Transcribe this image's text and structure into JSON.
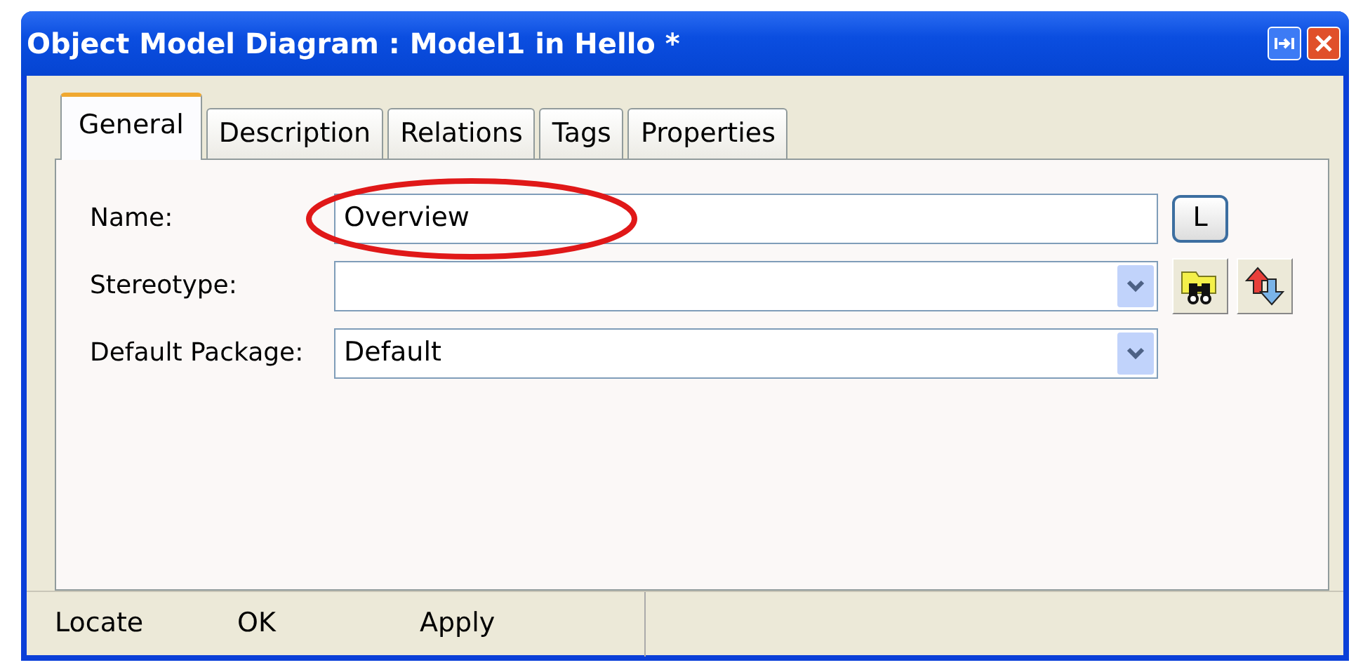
{
  "window": {
    "title": "Object Model Diagram : Model1 in Hello *"
  },
  "tabs": [
    {
      "label": "General",
      "selected": true
    },
    {
      "label": "Description",
      "selected": false
    },
    {
      "label": "Relations",
      "selected": false
    },
    {
      "label": "Tags",
      "selected": false
    },
    {
      "label": "Properties",
      "selected": false
    }
  ],
  "fields": [
    {
      "label": "Name:",
      "kind": "text",
      "value": "Overview",
      "button": "L"
    },
    {
      "label": "Stereotype:",
      "kind": "combo",
      "tools": true
    },
    {
      "label": "Default Package:",
      "kind": "combo",
      "value": "Default"
    }
  ],
  "footer_buttons": [
    "Locate",
    "OK",
    "Apply"
  ]
}
